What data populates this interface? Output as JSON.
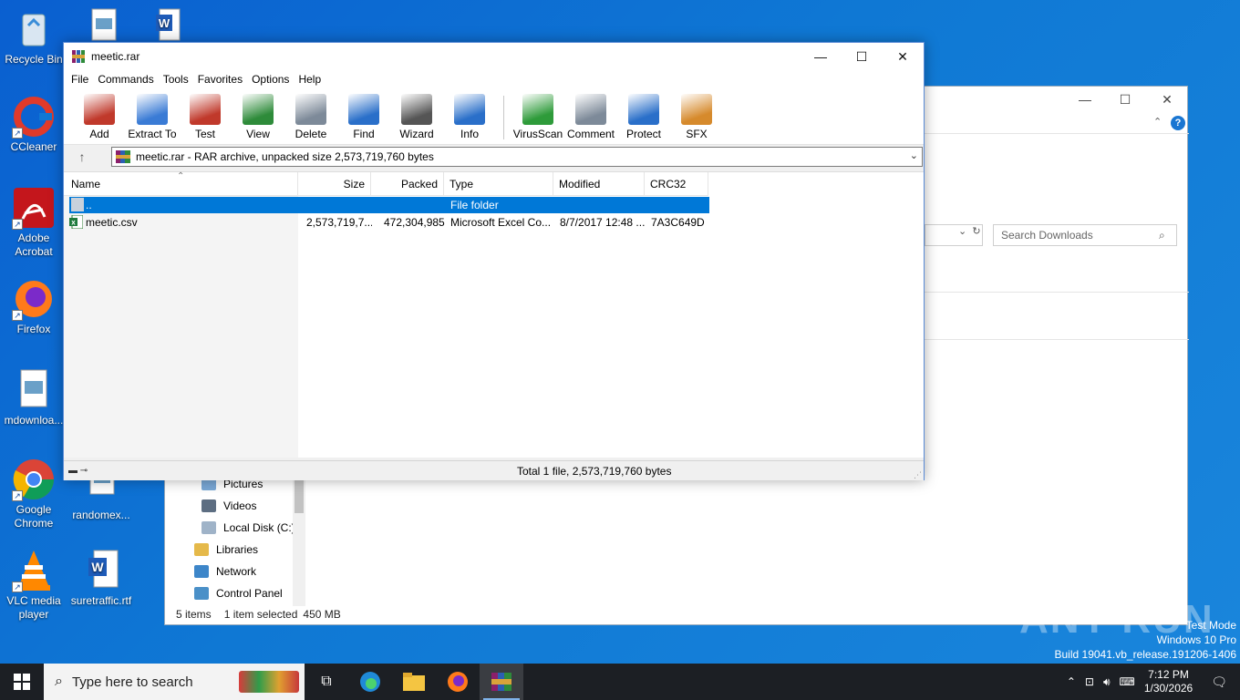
{
  "desktop": {
    "icons": [
      {
        "label": "Recycle Bin",
        "icon": "recycle-bin-icon"
      },
      {
        "label": "CCleaner",
        "icon": "ccleaner-icon"
      },
      {
        "label": "Adobe Acrobat",
        "icon": "acrobat-icon"
      },
      {
        "label": "Firefox",
        "icon": "firefox-icon"
      },
      {
        "label": "mdownloa...",
        "icon": "image-file-icon"
      },
      {
        "label": "Google Chrome",
        "icon": "chrome-icon"
      },
      {
        "label": "randomex...",
        "icon": "image-file-icon"
      },
      {
        "label": "VLC media player",
        "icon": "vlc-icon"
      },
      {
        "label": "suretraffic.rtf",
        "icon": "word-doc-icon"
      }
    ]
  },
  "explorer": {
    "search_placeholder": "Search Downloads",
    "nav": [
      "Pictures",
      "Videos",
      "Local Disk (C:)",
      "Libraries",
      "Network",
      "Control Panel"
    ],
    "status": {
      "items": "5 items",
      "selected": "1 item selected",
      "size": "450 MB"
    },
    "help_label": "?"
  },
  "winrar": {
    "title": "meetic.rar",
    "menu": [
      "File",
      "Commands",
      "Tools",
      "Favorites",
      "Options",
      "Help"
    ],
    "toolbar": [
      {
        "label": "Add",
        "icon": "add-archive-icon",
        "color": "#c0392b"
      },
      {
        "label": "Extract To",
        "icon": "extract-folder-icon",
        "color": "#3a7bd5"
      },
      {
        "label": "Test",
        "icon": "test-clipboard-icon",
        "color": "#c0392b"
      },
      {
        "label": "View",
        "icon": "view-book-icon",
        "color": "#2e8b3a"
      },
      {
        "label": "Delete",
        "icon": "delete-trash-icon",
        "color": "#7d8a99"
      },
      {
        "label": "Find",
        "icon": "find-magnifier-icon",
        "color": "#2a6fc9"
      },
      {
        "label": "Wizard",
        "icon": "wizard-wand-icon",
        "color": "#555555"
      },
      {
        "label": "Info",
        "icon": "info-icon",
        "color": "#2a6fc9"
      },
      {
        "label": "VirusScan",
        "icon": "virusscan-icon",
        "color": "#2e9b3a"
      },
      {
        "label": "Comment",
        "icon": "comment-icon",
        "color": "#7d8a99"
      },
      {
        "label": "Protect",
        "icon": "protect-shield-icon",
        "color": "#2a6fc9"
      },
      {
        "label": "SFX",
        "icon": "sfx-box-icon",
        "color": "#d68a2c"
      }
    ],
    "path": "meetic.rar - RAR archive, unpacked size 2,573,719,760 bytes",
    "columns": [
      "Name",
      "Size",
      "Packed",
      "Type",
      "Modified",
      "CRC32"
    ],
    "rows": [
      {
        "name": "..",
        "size": "",
        "packed": "",
        "type": "File folder",
        "modified": "",
        "crc": "",
        "selected": true
      },
      {
        "name": "meetic.csv",
        "size": "2,573,719,7...",
        "packed": "472,304,985",
        "type": "Microsoft Excel Co...",
        "modified": "8/7/2017 12:48 ...",
        "crc": "7A3C649D",
        "selected": false
      }
    ],
    "status": "Total 1 file, 2,573,719,760 bytes"
  },
  "watermark": "ANY RUN",
  "testmode": {
    "line1": "Test Mode",
    "line2": "Windows 10 Pro",
    "line3": "Build 19041.vb_release.191206-1406"
  },
  "taskbar": {
    "search_placeholder": "Type here to search",
    "time": "7:12 PM",
    "date": "1/30/2026"
  }
}
